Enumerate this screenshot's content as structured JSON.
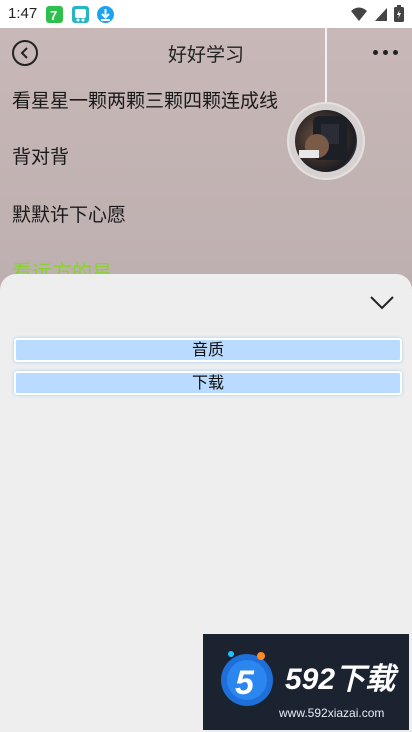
{
  "status_bar": {
    "time": "1:47",
    "app_icons": [
      "app-7-icon",
      "app-bus-icon",
      "download-icon"
    ],
    "right_icons": [
      "wifi-icon",
      "signal-icon",
      "battery-icon"
    ]
  },
  "header": {
    "title": "好好学习",
    "back_icon": "back-arrow-icon",
    "more_icon": "more-dots-icon"
  },
  "lyrics": [
    {
      "text": "看星星一颗两颗三颗四颗连成线",
      "active": false
    },
    {
      "text": "背对背",
      "active": false
    },
    {
      "text": "默默许下心愿",
      "active": false
    },
    {
      "text": "看远方的星",
      "active": true
    }
  ],
  "sheet": {
    "collapse_icon": "chevron-down-icon",
    "options": [
      {
        "label": "音质"
      },
      {
        "label": "下载"
      }
    ]
  },
  "watermark": {
    "brand": "592下载",
    "url": "www.592xiazai.com"
  },
  "colors": {
    "active_lyric": "#8bd136",
    "option_bg": "#b8dbff"
  }
}
